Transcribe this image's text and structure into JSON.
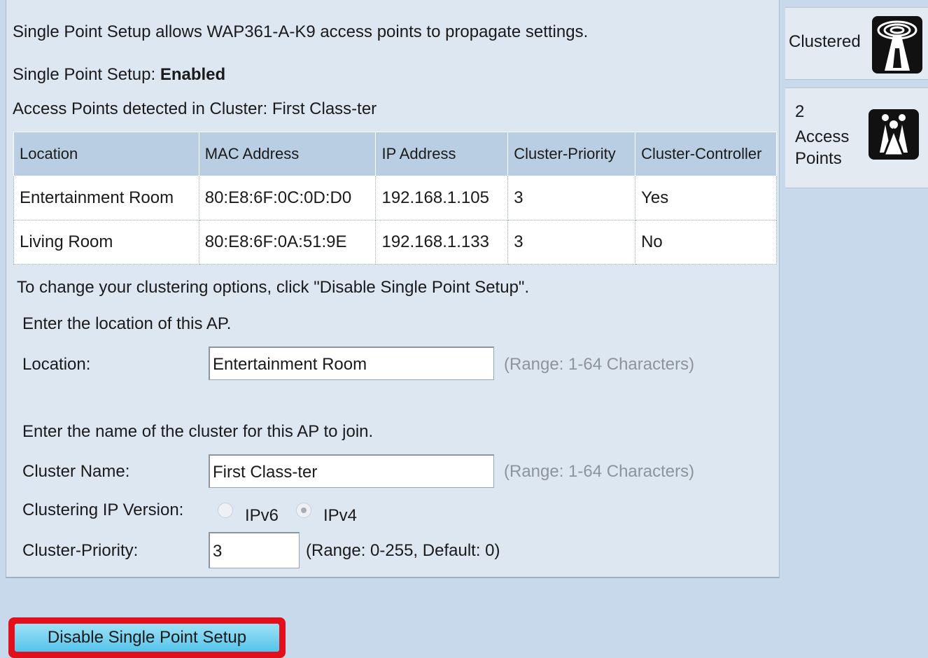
{
  "intro_text": "Single Point Setup allows WAP361-A-K9 access points to propagate settings.",
  "status": {
    "label": "Single Point Setup: ",
    "value": "Enabled"
  },
  "cluster_detected_text": "Access Points detected in Cluster: First Class-ter",
  "table": {
    "headers": [
      "Location",
      "MAC Address",
      "IP Address",
      "Cluster-Priority",
      "Cluster-Controller"
    ],
    "rows": [
      [
        "Entertainment Room",
        "80:E8:6F:0C:0D:D0",
        "192.168.1.105",
        "3",
        "Yes"
      ],
      [
        "Living Room",
        "80:E8:6F:0A:51:9E",
        "192.168.1.133",
        "3",
        "No"
      ]
    ]
  },
  "change_hint": "To change your clustering options, click \"Disable Single Point Setup\".",
  "location_section": {
    "prompt": "Enter the location of this AP.",
    "label": "Location:",
    "value": "Entertainment Room",
    "range": "(Range: 1-64 Characters)"
  },
  "cluster_section": {
    "prompt": "Enter the name of the cluster for this AP to join.",
    "label": "Cluster Name:",
    "value": "First Class-ter",
    "range": "(Range: 1-64 Characters)"
  },
  "ip_version": {
    "label": "Clustering IP Version:",
    "options": [
      "IPv6",
      "IPv4"
    ],
    "selected": "IPv4"
  },
  "priority": {
    "label": "Cluster-Priority:",
    "value": "3",
    "range": "(Range: 0-255, Default: 0)"
  },
  "disable_button_label": "Disable Single Point Setup",
  "sidebar": {
    "clustered_label": "Clustered",
    "clustered_icon": "antenna-icon",
    "ap_count": "2",
    "ap_label_line1": "Access",
    "ap_label_line2": "Points",
    "ap_icon": "users-icon"
  },
  "colors": {
    "highlight": "#e3101b",
    "button": "#54c4ea",
    "header": "#b9cee2"
  }
}
